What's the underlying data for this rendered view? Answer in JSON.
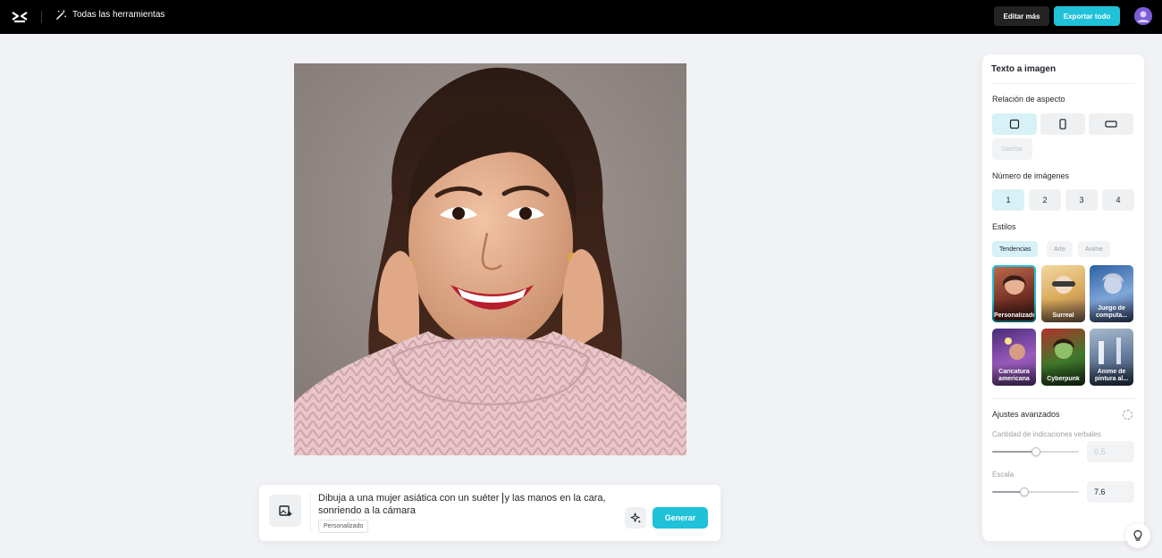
{
  "topbar": {
    "tools_label": "Todas las herramientas",
    "edit_more_label": "Editar más",
    "export_all_label": "Exportar todo"
  },
  "main_image": {
    "alt": "Mujer asiática sonriendo con suéter rosa y manos en la cara"
  },
  "prompt": {
    "text_before_caret": "Dibuja a una mujer asiática con un suéter ",
    "text_after_caret": "y las manos en la cara, sonriendo a la cámara",
    "tag_label": "Personalizado",
    "generate_label": "Generar"
  },
  "panel": {
    "title": "Texto a imagen",
    "aspect_label": "Relación de aspecto",
    "aspect_options": [
      "1:1",
      "3:4",
      "16:9"
    ],
    "aspect_selected": "1:1",
    "aspect_custom_label": "Diseñar",
    "count_label": "Número de imágenes",
    "counts": [
      "1",
      "2",
      "3",
      "4"
    ],
    "count_selected": "1",
    "styles_label": "Estilos",
    "style_tabs": [
      "Tendencias",
      "Arte",
      "Anime"
    ],
    "style_tab_selected": "Tendencias",
    "style_cards": [
      {
        "label": "Personalizado"
      },
      {
        "label": "Surreal"
      },
      {
        "label": "Juego de computa..."
      },
      {
        "label": "Caricatura americana"
      },
      {
        "label": "Cyberpunk"
      },
      {
        "label": "Anime de pintura al..."
      }
    ],
    "advanced_label": "Ajustes avanzados",
    "prompt_weight_label": "Cantidad de indicaciones verbales",
    "prompt_weight_value": "0.5",
    "prompt_weight_fraction": 0.5,
    "scale_label": "Escala",
    "scale_value": "7.6",
    "scale_fraction": 0.37
  },
  "colors": {
    "accent": "#1fc2d9",
    "accent_light": "#d7f1f6",
    "topbar_bg": "#000000",
    "page_bg": "#f0f2f5"
  },
  "icons": {
    "logo": "capcut-logo-icon",
    "tools": "magic-wand-icon",
    "prompt_image": "image-add-icon",
    "prompt_magic": "sparkle-icon",
    "help": "lightbulb-icon"
  }
}
